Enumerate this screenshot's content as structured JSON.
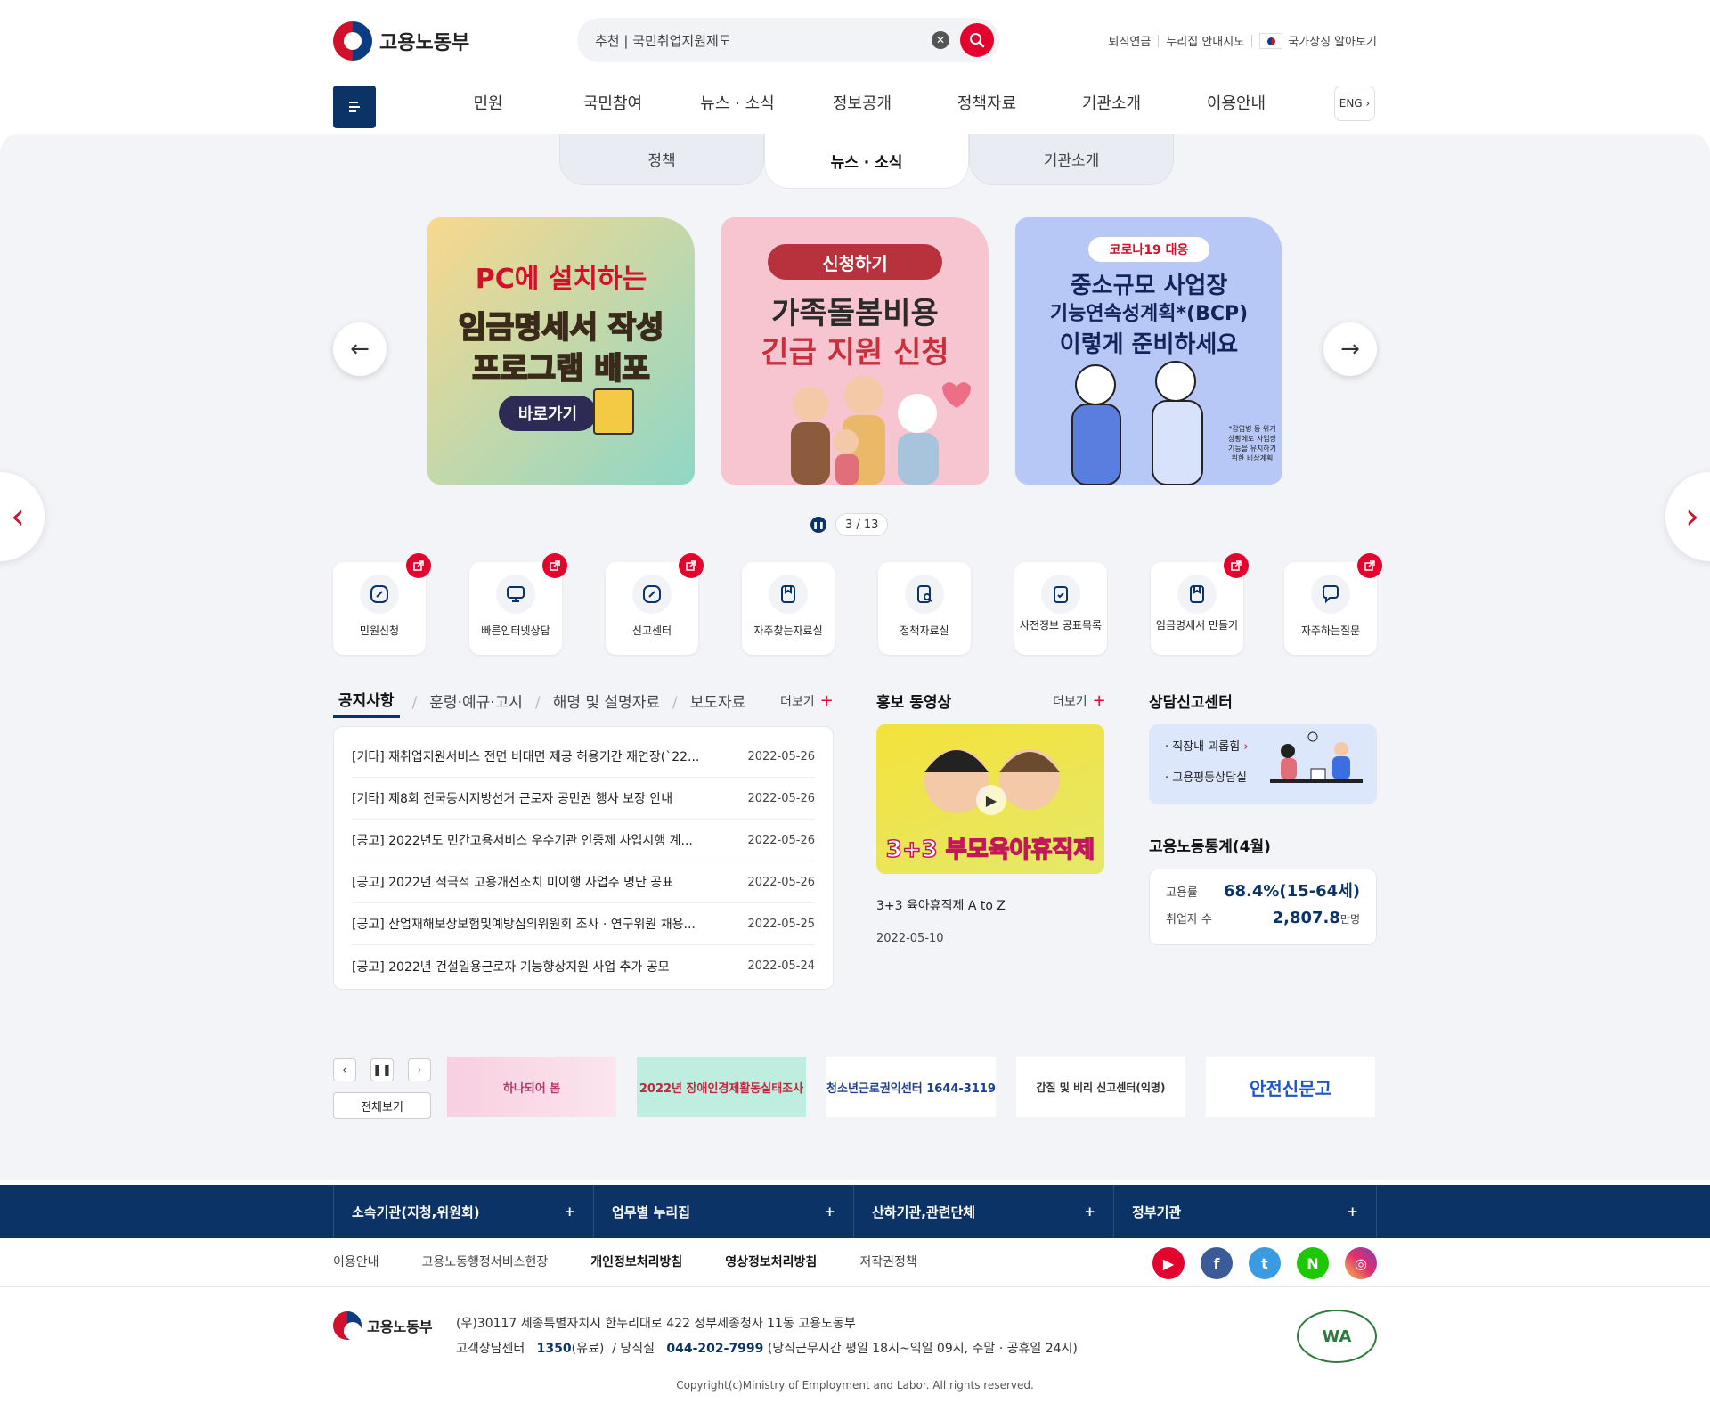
{
  "header": {
    "logo_text": "고용노동부",
    "search_text": "추천 | 국민취업지원제도",
    "top_links": [
      "퇴직연금",
      "누리집 안내지도",
      "국가상징 알아보기"
    ],
    "gnb": [
      "민원",
      "국민참여",
      "뉴스 · 소식",
      "정보공개",
      "정책자료",
      "기관소개",
      "이용안내"
    ],
    "eng_label": "ENG"
  },
  "tabs": [
    "정책",
    "뉴스 · 소식",
    "기관소개"
  ],
  "slides": [
    {
      "l1": "PC에 설치하는",
      "l2": "임금명세서 작성",
      "l3": "프로그램 배포",
      "btn": "바로가기"
    },
    {
      "l1": "신청하기",
      "l2": "가족돌봄비용",
      "l3": "긴급 지원 신청"
    },
    {
      "l1": "코로나19 대응",
      "l2": "중소규모 사업장",
      "l3": "기능연속성계획*(BCP)",
      "l4": "이렇게 준비하세요",
      "note": "*감염병 등 위기상황에도 사업장 기능을 유지하기 위한 비상계획"
    }
  ],
  "pager": "3 / 13",
  "quick_menu": [
    "민원신청",
    "빠른인터넷상담",
    "신고센터",
    "자주찾는자료실",
    "정책자료실",
    "사전정보 공표목록",
    "임금명세서 만들기",
    "자주하는질문"
  ],
  "notice": {
    "tabs": [
      "공지사항",
      "훈령·예규·고시",
      "해명 및 설명자료",
      "보도자료"
    ],
    "more": "더보기",
    "items": [
      {
        "title": "[기타] 재취업지원서비스 전면 비대면 제공 허용기간 재연장(`22...",
        "date": "2022-05-26"
      },
      {
        "title": "[기타] 제8회 전국동시지방선거 근로자 공민권 행사 보장 안내",
        "date": "2022-05-26"
      },
      {
        "title": "[공고] 2022년도 민간고용서비스 우수기관 인증제 사업시행 계...",
        "date": "2022-05-26"
      },
      {
        "title": "[공고] 2022년 적극적 고용개선조치 미이행 사업주 명단 공표",
        "date": "2022-05-26"
      },
      {
        "title": "[공고] 산업재해보상보험및예방심의위원회 조사 · 연구위원 채용...",
        "date": "2022-05-25"
      },
      {
        "title": "[공고] 2022년 건설일용근로자 기능향상지원 사업 추가 공모",
        "date": "2022-05-24"
      }
    ]
  },
  "video": {
    "title": "홍보 동영상",
    "more": "더보기",
    "thumb_text": "3+3 부모육아휴직제",
    "caption": "3+3 육아휴직제 A to Z",
    "date": "2022-05-10"
  },
  "consult": {
    "title": "상담신고센터",
    "items": [
      "직장내 괴롭힘",
      "고용평등상담실"
    ]
  },
  "stats": {
    "title": "고용노동통계(4월)",
    "rows": [
      {
        "k": "고용률",
        "v": "68.4%(15-64세)"
      },
      {
        "k": "취업자 수",
        "v": "2,807.8",
        "unit": "만명"
      }
    ]
  },
  "banners": {
    "all": "전체보기",
    "items": [
      "하나되어 봄",
      "2022년 장애인경제활동실태조사",
      "청소년근로권익센터 1644-3119",
      "갑질 및 비리 신고센터(익명)",
      "안전신문고"
    ]
  },
  "footer": {
    "cols": [
      "소속기관(지청,위원회)",
      "업무별 누리집",
      "산하기관,관련단체",
      "정부기관"
    ],
    "links": [
      "이용안내",
      "고용노동행정서비스현장",
      "개인정보처리방침",
      "영상정보처리방침",
      "저작권정책"
    ],
    "logo_text": "고용노동부",
    "address": "(우)30117 세종특별자치시 한누리대로 422 정부세종청사 11동 고용노동부",
    "center_label": "고객상담센터",
    "center_num": "1350",
    "center_paid": "(유료)",
    "duty_label": "/ 당직실",
    "duty_num": "044-202-7999",
    "duty_hours": "(당직근무시간 평일 18시~익일 09시, 주말 · 공휴일 24시)",
    "copyright": "Copyright(c)Ministry of Employment and Labor. All rights reserved.",
    "wa": "WA"
  },
  "colors": {
    "brand_navy": "#0c3366",
    "brand_red": "#e4032c"
  }
}
